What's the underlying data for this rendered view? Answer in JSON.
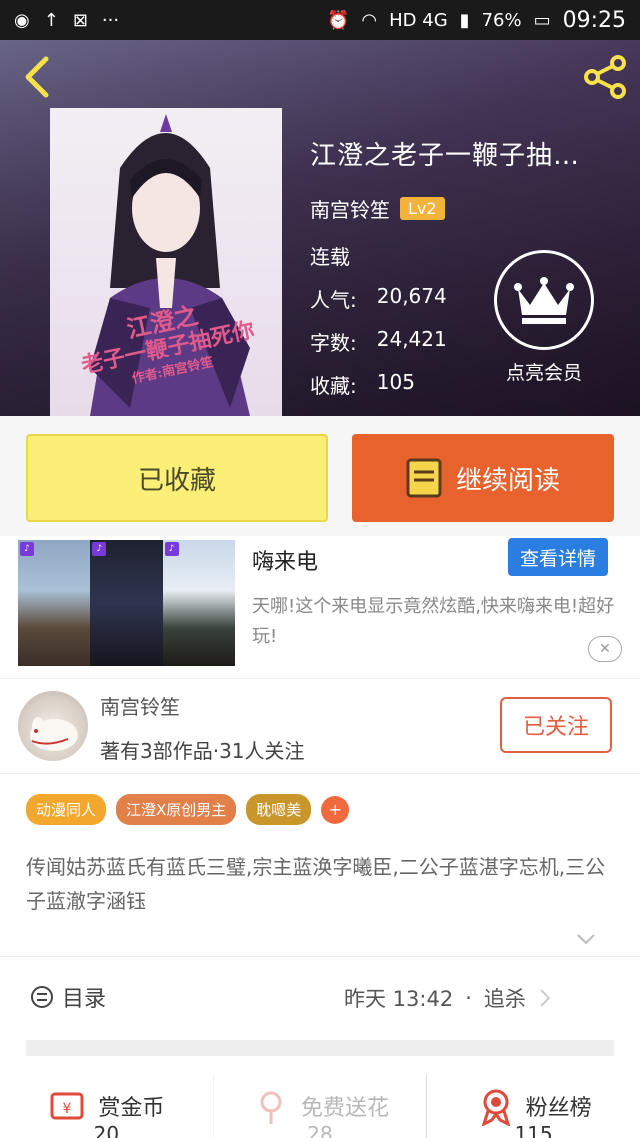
{
  "status_bar": {
    "battery": "76%",
    "time": "09:25",
    "network": "HD 4G",
    "dots": "···"
  },
  "book": {
    "title": "江澄之老子一鞭子抽…",
    "author": "南宫铃笙",
    "level": "Lv2",
    "status": "连载",
    "popularity_label": "人气:",
    "popularity": "20,674",
    "words_label": "字数:",
    "words": "24,421",
    "collect_label": "收藏:",
    "collect": "105",
    "cover_title_1": "江澄之",
    "cover_title_2": "老子一鞭子抽死你",
    "cover_author": "作者:南宫铃笙"
  },
  "vip": {
    "label": "点亮会员"
  },
  "actions": {
    "collected": "已收藏",
    "continue": "继续阅读"
  },
  "ad": {
    "title": "嗨来电",
    "detail_button": "查看详情",
    "description": "天哪!这个来电显示竟然炫酷,快来嗨来电!超好玩!"
  },
  "author_card": {
    "name": "南宫铃笙",
    "meta": "著有3部作品·31人关注",
    "follow_label": "已关注"
  },
  "tags": [
    {
      "label": "动漫同人",
      "color": "#f3a82d"
    },
    {
      "label": "江澄X原创男主",
      "color": "#e2804a"
    },
    {
      "label": "耽嗯美",
      "color": "#c9962c"
    }
  ],
  "tag_add": "+",
  "summary": "传闻姑苏蓝氏有蓝氏三璧,宗主蓝涣字曦臣,二公子蓝湛字忘机,三公子蓝澈字涵钰",
  "toc": {
    "label": "目录",
    "updated": "昨天 13:42",
    "sep": "·",
    "latest": "追杀"
  },
  "rewards": [
    {
      "label": "赏金币",
      "count": "20",
      "icon": "coin-icon"
    },
    {
      "label": "免费送花",
      "count": "28",
      "icon": "flower-icon"
    },
    {
      "label": "粉丝榜",
      "count": "115",
      "icon": "ribbon-icon"
    }
  ]
}
